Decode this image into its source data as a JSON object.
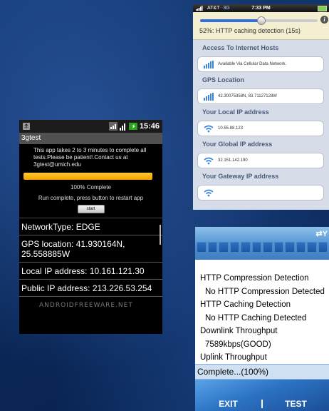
{
  "android": {
    "status_time": "15:46",
    "title": "3gtest",
    "message": "This app takes 2 to 3 minutes to complete all tests.Please be patient!.Contact us at 3gtest@umich.edu",
    "progress_percent": 100,
    "complete_text": "100% Complete",
    "run_text": "Run complete, press button to restart app",
    "start_label": "start",
    "items": [
      "NetworkType: EDGE",
      "GPS location: 41.930164N, 25.558885W",
      "Local IP address: 10.161.121.30",
      "Public IP address: 213.226.53.254"
    ],
    "watermark": "ANDROIDFREEWARE.NET"
  },
  "iphone": {
    "carrier": "AT&T",
    "network": "3G",
    "time": "7:33 PM",
    "slider_percent": 52,
    "info_glyph": "i",
    "header_text": "52%: HTTP caching detection (15s)",
    "sections": [
      {
        "title": "Access To Internet Hosts",
        "value": "Available Via Cellular Data Network.",
        "icon": "signal-bars-icon"
      },
      {
        "title": "GPS Location",
        "value": "42.30075358N, 83.71127128W",
        "icon": "signal-bars-icon"
      },
      {
        "title": "Your Local IP address",
        "value": "10.55.88.123",
        "icon": "wifi-icon"
      },
      {
        "title": "Your Global IP address",
        "value": "32.151.142.190",
        "icon": "wifi-icon"
      },
      {
        "title": "Your Gateway IP address",
        "value": "",
        "icon": "wifi-icon"
      }
    ]
  },
  "winmobile": {
    "status_icons": "⇄Y",
    "lines": [
      {
        "text": "HTTP Compression Detection",
        "sub": false
      },
      {
        "text": "No HTTP Compression Detected",
        "sub": true
      },
      {
        "text": "HTTP Caching Detection",
        "sub": false
      },
      {
        "text": "No HTTP Caching Detected",
        "sub": true
      },
      {
        "text": "Downlink Throughput",
        "sub": false
      },
      {
        "text": "7589kbps(GOOD)",
        "sub": true
      },
      {
        "text": "Uplink Throughput",
        "sub": false
      }
    ],
    "status": "Complete...(100%)",
    "left_soft": "EXIT",
    "right_soft": "TEST"
  }
}
